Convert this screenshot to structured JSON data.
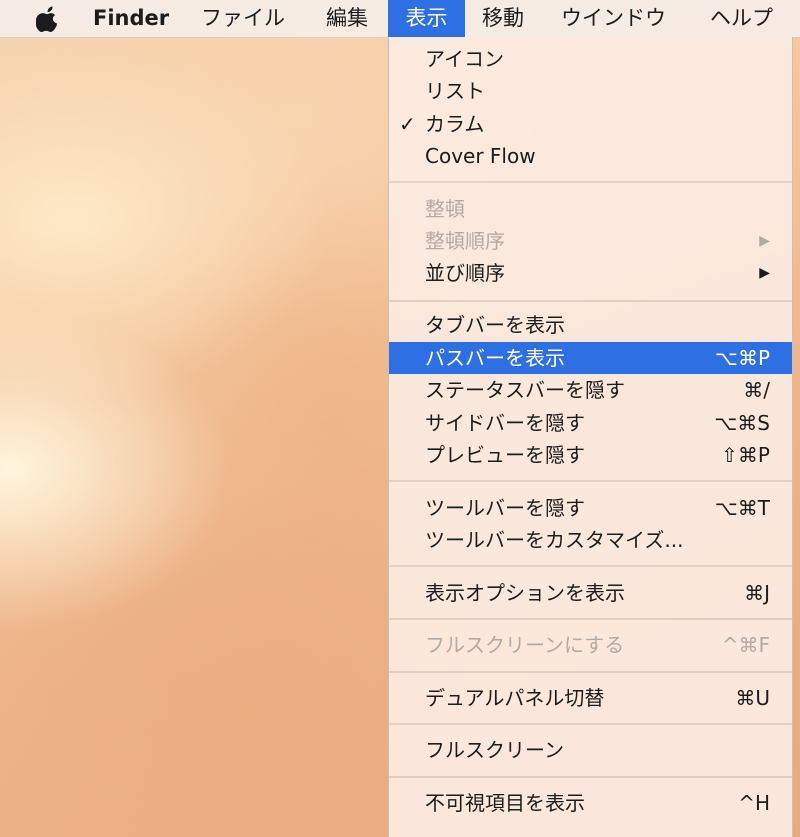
{
  "menubar": {
    "apple_icon": "apple-logo",
    "app_name": "Finder",
    "items": [
      "ファイル",
      "編集",
      "表示",
      "移動",
      "ウインドウ",
      "ヘルプ"
    ]
  },
  "view_menu": {
    "items": [
      {
        "label": "アイコン",
        "checked": false,
        "enabled": true
      },
      {
        "label": "リスト",
        "checked": false,
        "enabled": true
      },
      {
        "label": "カラム",
        "checked": true,
        "check_glyph": "✓",
        "enabled": true
      },
      {
        "label": "Cover Flow",
        "checked": false,
        "enabled": true
      },
      {
        "label": "整頓",
        "enabled": false
      },
      {
        "label": "整頓順序",
        "enabled": false,
        "submenu": true,
        "arrow": "▶"
      },
      {
        "label": "並び順序",
        "enabled": true,
        "submenu": true,
        "arrow": "▶"
      },
      {
        "label": "タブバーを表示",
        "enabled": true
      },
      {
        "label": "パスバーを表示",
        "enabled": true,
        "highlighted": true,
        "shortcut": "⌥⌘P"
      },
      {
        "label": "ステータスバーを隠す",
        "enabled": true,
        "shortcut": "⌘/"
      },
      {
        "label": "サイドバーを隠す",
        "enabled": true,
        "shortcut": "⌥⌘S"
      },
      {
        "label": "プレビューを隠す",
        "enabled": true,
        "shortcut": "⇧⌘P"
      },
      {
        "label": "ツールバーを隠す",
        "enabled": true,
        "shortcut": "⌥⌘T"
      },
      {
        "label": "ツールバーをカスタマイズ...",
        "enabled": true
      },
      {
        "label": "表示オプションを表示",
        "enabled": true,
        "shortcut": "⌘J"
      },
      {
        "label": "フルスクリーンにする",
        "enabled": false,
        "shortcut": "^⌘F"
      },
      {
        "label": "デュアルパネル切替",
        "enabled": true,
        "shortcut": "⌘U"
      },
      {
        "label": "フルスクリーン",
        "enabled": true
      },
      {
        "label": "不可視項目を表示",
        "enabled": true,
        "shortcut": "^H"
      }
    ]
  },
  "colors": {
    "highlight": "#2f6fe4",
    "disabled_text": "#b3aaa5"
  }
}
